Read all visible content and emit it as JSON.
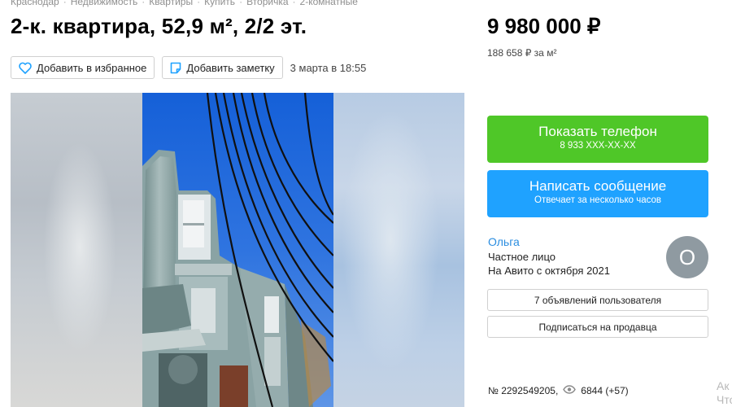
{
  "breadcrumbs": [
    "Краснодар",
    "Недвижимость",
    "Квартиры",
    "Купить",
    "Вторичка",
    "2-комнатные"
  ],
  "breadcrumb_separator": "·",
  "listing": {
    "title": "2-к. квартира, 52,9 м², 2/2 эт.",
    "price": "9 980 000 ₽",
    "price_per_sqm": "188 658 ₽ за м²",
    "date": "3 марта в 18:55",
    "ad_number": "№ 2292549205",
    "views": "6844 (+57)"
  },
  "actions": {
    "favorite_label": "Добавить в избранное",
    "note_label": "Добавить заметку"
  },
  "contact": {
    "phone_title": "Показать телефон",
    "phone_masked": "8 933 XXX-XX-XX",
    "message_title": "Написать сообщение",
    "message_sub": "Отвечает за несколько часов"
  },
  "seller": {
    "name": "Ольга",
    "type": "Частное лицо",
    "since": "На Авито с октября 2021",
    "avatar_letter": "О",
    "listings_button": "7 объявлений пользователя",
    "subscribe_button": "Подписаться на продавца"
  },
  "side_ghost": {
    "line1": "Ак",
    "line2": "Что"
  },
  "colors": {
    "phone_button": "#4fc728",
    "message_button": "#1fa2ff",
    "seller_link": "#2a8de0",
    "avatar_bg": "#8f9aa1"
  },
  "icons": [
    "heart-icon",
    "note-icon",
    "eye-icon"
  ]
}
